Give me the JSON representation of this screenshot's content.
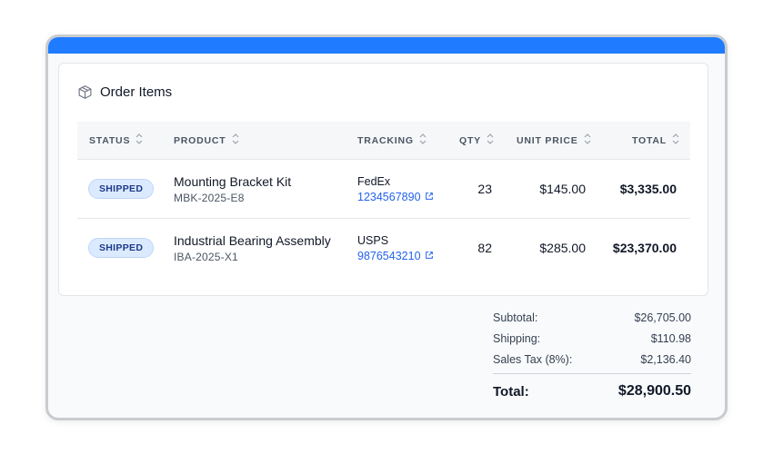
{
  "card": {
    "title": "Order Items",
    "icon": "package-icon"
  },
  "table": {
    "columns": {
      "status": "STATUS",
      "product": "PRODUCT",
      "tracking": "TRACKING",
      "qty": "QTY",
      "unit_price": "UNIT PRICE",
      "total": "TOTAL"
    },
    "rows": [
      {
        "status": "SHIPPED",
        "product_name": "Mounting Bracket Kit",
        "sku": "MBK-2025-E8",
        "carrier": "FedEx",
        "tracking_number": "1234567890",
        "qty": "23",
        "unit_price": "$145.00",
        "total": "$3,335.00"
      },
      {
        "status": "SHIPPED",
        "product_name": "Industrial Bearing Assembly",
        "sku": "IBA-2025-X1",
        "carrier": "USPS",
        "tracking_number": "9876543210",
        "qty": "82",
        "unit_price": "$285.00",
        "total": "$23,370.00"
      }
    ]
  },
  "summary": {
    "subtotal_label": "Subtotal:",
    "subtotal_value": "$26,705.00",
    "shipping_label": "Shipping:",
    "shipping_value": "$110.98",
    "tax_label": "Sales Tax (8%):",
    "tax_value": "$2,136.40",
    "total_label": "Total:",
    "total_value": "$28,900.50"
  },
  "colors": {
    "accent": "#1f7bff",
    "link": "#2563eb",
    "badge_bg": "#dbeafe",
    "badge_text": "#1e3a8a"
  }
}
